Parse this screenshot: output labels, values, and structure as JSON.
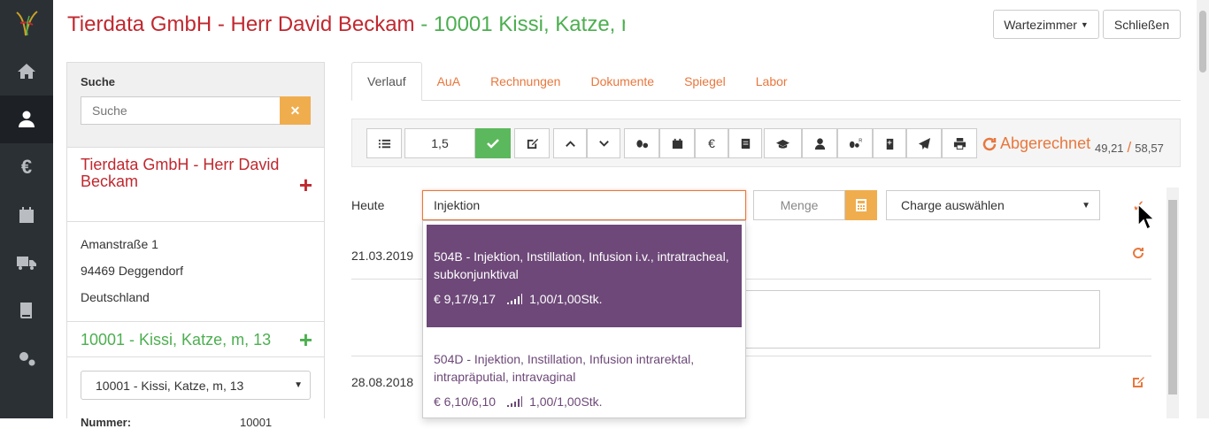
{
  "header": {
    "title_red": "Tierdata GmbH - Herr David Beckam",
    "title_sep": " - ",
    "title_green": "10001 Kissi, Katze, m",
    "waiting_room_btn": "Wartezimmer",
    "close_btn": "Schließen"
  },
  "sidebar": {
    "items": [
      {
        "icon": "home-icon"
      },
      {
        "icon": "patient-icon",
        "active": true
      },
      {
        "icon": "euro-icon"
      },
      {
        "icon": "calendar-icon"
      },
      {
        "icon": "truck-icon"
      },
      {
        "icon": "book-icon"
      },
      {
        "icon": "settings-icon"
      }
    ]
  },
  "left": {
    "search_label": "Suche",
    "search_placeholder": "Suche",
    "owner_name": "Tierdata GmbH - Herr David Beckam",
    "address": [
      "Amanstraße 1",
      "94469 Deggendorf",
      "Deutschland"
    ],
    "pet_name": "10001 - Kissi, Katze, m, 13",
    "pet_select": "10001 - Kissi, Katze, m, 13",
    "number_label": "Nummer:",
    "number_value": "10001"
  },
  "tabs": [
    "Verlauf",
    "AuA",
    "Rechnungen",
    "Dokumente",
    "Spiegel",
    "Labor"
  ],
  "toolbar": {
    "factor_value": "1,5",
    "billed_label": "Abgerechnet",
    "billed_value": "49,21",
    "total_value": "58,57",
    "separator": "/"
  },
  "entry": {
    "today_label": "Heute",
    "search_value": "Injektion",
    "amount_placeholder": "Menge",
    "charge_select": "Charge auswählen"
  },
  "history": {
    "dates": [
      "21.03.2019",
      "28.08.2018"
    ]
  },
  "dropdown": {
    "items": [
      {
        "title": "504B - Injektion, Instillation, Infusion i.v., intratracheal, subkonjunktival",
        "price": "€ 9,17/9,17",
        "qty": "1,00/1,00Stk."
      },
      {
        "title": "504D - Injektion, Instillation, Infusion intrarektal, intrapräputial, intravaginal",
        "price": "€ 6,10/6,10",
        "qty": "1,00/1,00Stk."
      }
    ]
  },
  "colors": {
    "accent": "#e8773d",
    "brand_red": "#c0282f",
    "green": "#4caf50",
    "highlight": "#6d4878",
    "sidebar": "#2b3035"
  }
}
